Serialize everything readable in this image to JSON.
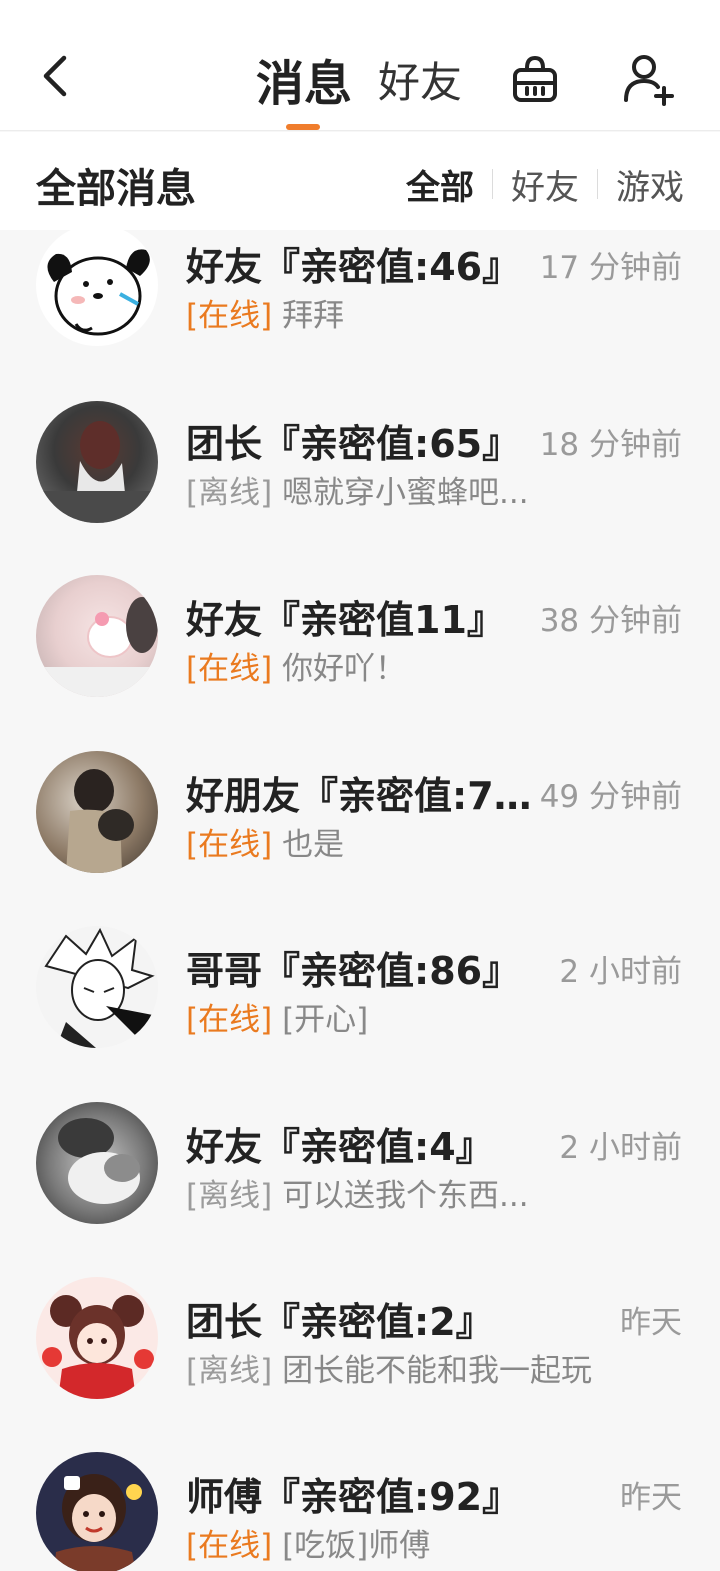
{
  "header": {
    "tabs": [
      {
        "label": "消息",
        "active": true
      },
      {
        "label": "好友",
        "active": false
      }
    ],
    "accent_color": "#f07d2c"
  },
  "filterbar": {
    "title": "全部消息",
    "filters": [
      {
        "label": "全部",
        "active": true
      },
      {
        "label": "好友",
        "active": false
      },
      {
        "label": "游戏",
        "active": false
      }
    ]
  },
  "messages": [
    {
      "name": "好友『亲密值:46』",
      "time": "17 分钟前",
      "status": "[在线]",
      "online": true,
      "preview": "拜拜",
      "avatar_icon": "cartoon-dog-avatar"
    },
    {
      "name": "团长『亲密值:65』",
      "time": "18 分钟前",
      "status": "[离线]",
      "online": false,
      "preview": "嗯就穿小蜜蜂吧...",
      "avatar_icon": "photo-avatar"
    },
    {
      "name": "好友『亲密值11』",
      "time": "38 分钟前",
      "status": "[在线]",
      "online": true,
      "preview": "你好吖！",
      "avatar_icon": "photo-avatar"
    },
    {
      "name": "好朋友『亲密值:72...",
      "time": "49 分钟前",
      "status": "[在线]",
      "online": true,
      "preview": "也是",
      "avatar_icon": "photo-avatar"
    },
    {
      "name": "哥哥『亲密值:86』",
      "time": "2 小时前",
      "status": "[在线]",
      "online": true,
      "preview": "[开心]",
      "avatar_icon": "manga-avatar"
    },
    {
      "name": "好友『亲密值:4』",
      "time": "2 小时前",
      "status": "[离线]",
      "online": false,
      "preview": "可以送我个东西...",
      "avatar_icon": "photo-avatar"
    },
    {
      "name": "团长『亲密值:2』",
      "time": "昨天",
      "status": "[离线]",
      "online": false,
      "preview": "团长能不能和我一起玩",
      "avatar_icon": "anime-girl-avatar"
    },
    {
      "name": "师傅『亲密值:92』",
      "time": "昨天",
      "status": "[在线]",
      "online": true,
      "preview": "[吃饭]师傅",
      "avatar_icon": "cartoon-girl-avatar"
    }
  ]
}
